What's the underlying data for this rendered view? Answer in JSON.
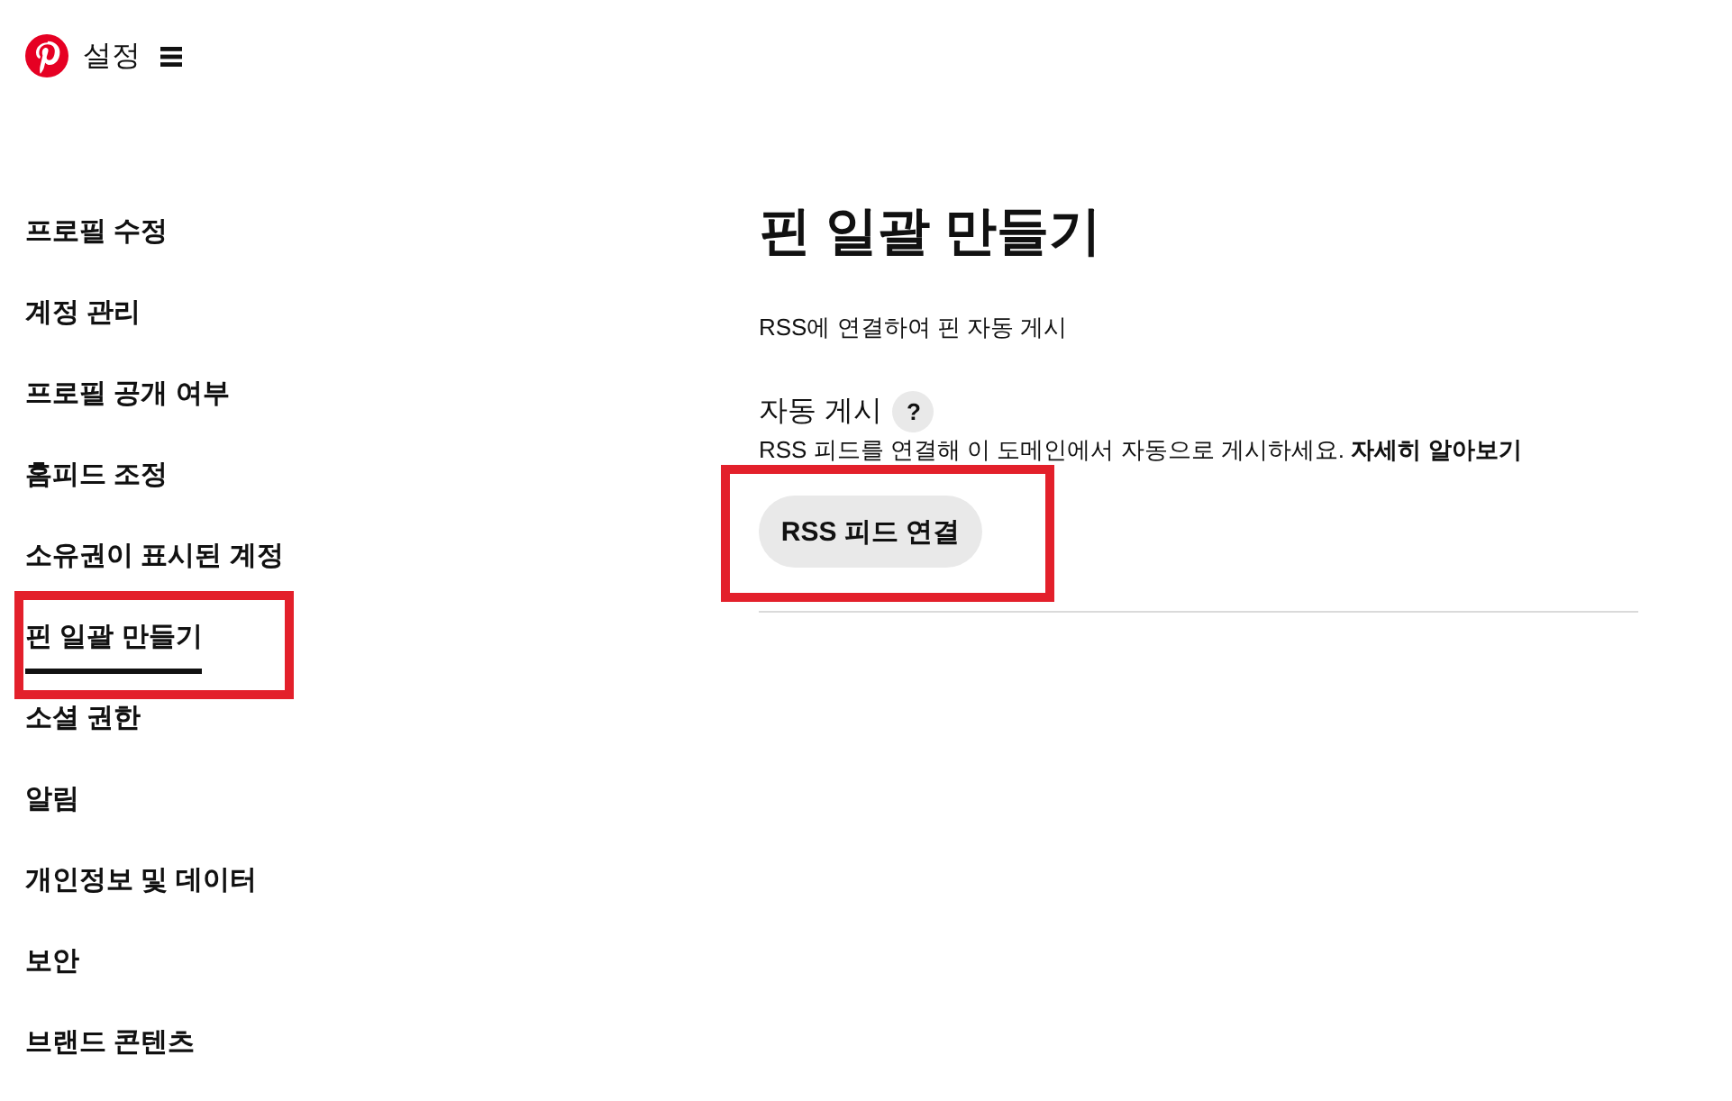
{
  "header": {
    "title": "설정"
  },
  "sidebar": {
    "items": [
      {
        "label": "프로필 수정",
        "selected": false,
        "highlighted": false
      },
      {
        "label": "계정 관리",
        "selected": false,
        "highlighted": false
      },
      {
        "label": "프로필 공개 여부",
        "selected": false,
        "highlighted": false
      },
      {
        "label": "홈피드 조정",
        "selected": false,
        "highlighted": false
      },
      {
        "label": "소유권이 표시된 계정",
        "selected": false,
        "highlighted": false
      },
      {
        "label": "핀 일괄 만들기",
        "selected": true,
        "highlighted": true
      },
      {
        "label": "소셜 권한",
        "selected": false,
        "highlighted": false
      },
      {
        "label": "알림",
        "selected": false,
        "highlighted": false
      },
      {
        "label": "개인정보 및 데이터",
        "selected": false,
        "highlighted": false
      },
      {
        "label": "보안",
        "selected": false,
        "highlighted": false
      },
      {
        "label": "브랜드 콘텐츠",
        "selected": false,
        "highlighted": false
      }
    ]
  },
  "main": {
    "title": "핀 일괄 만들기",
    "subtitle": "RSS에 연결하여 핀 자동 게시",
    "section": {
      "heading": "자동 게시",
      "help": "?",
      "description": "RSS 피드를 연결해 이 도메인에서 자동으로 게시하세요.",
      "link": "자세히 알아보기",
      "button": {
        "label": "RSS 피드 연결",
        "highlighted": true
      }
    }
  }
}
